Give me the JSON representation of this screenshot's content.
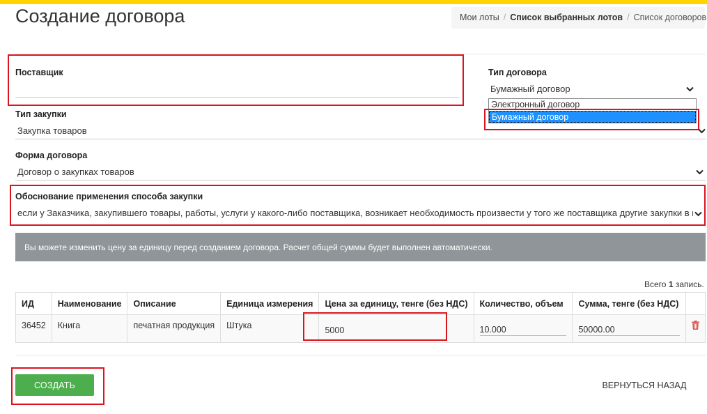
{
  "page": {
    "title": "Создание договора"
  },
  "breadcrumb": {
    "items": [
      "Мои лоты",
      "Список выбранных лотов",
      "Список договоров"
    ],
    "separator": "/"
  },
  "form": {
    "supplier": {
      "label": "Поставщик",
      "value": ""
    },
    "contract_type": {
      "label": "Тип договора",
      "value": "Бумажный договор",
      "options": [
        "Электронный договор",
        "Бумажный договор"
      ],
      "selected_index": 1,
      "dropdown_open": true
    },
    "purchase_type": {
      "label": "Тип закупки",
      "value": "Закупка товаров"
    },
    "contract_form": {
      "label": "Форма договора",
      "value": "Договор о закупках товаров"
    },
    "justification": {
      "label": "Обоснование применения способа закупки",
      "value": "если у Заказчика, закупившего товары, работы, услуги у какого-либо поставщика, возникает необходимость произвести у того же поставщика другие закупки в целях"
    }
  },
  "info_bar": {
    "text": "Вы можете изменить цену за единицу перед созданием договора. Расчет общей суммы будет выполнен автоматически."
  },
  "total": {
    "prefix": "Всего",
    "count": "1",
    "suffix": "запись."
  },
  "table": {
    "headers": [
      "ИД",
      "Наименование",
      "Описание",
      "Единица измерения",
      "Цена за единицу, тенге (без НДС)",
      "Количество, объем",
      "Сумма, тенге (без НДС)"
    ],
    "rows": [
      {
        "id": "36452",
        "name": "Книга",
        "description": "печатная продукция",
        "unit": "Штука",
        "price": "5000",
        "quantity": "10.000",
        "sum": "50000.00"
      }
    ]
  },
  "actions": {
    "create_label": "СОЗДАТЬ",
    "back_label": "ВЕРНУТЬСЯ НАЗАД"
  },
  "colors": {
    "accent_topbar": "#ffd400",
    "highlight_red": "#d9141e",
    "create_button": "#4cae4c",
    "info_bar": "#8f9598",
    "selected_option": "#1e90ff",
    "trash": "#d9534f"
  },
  "icons": {
    "dropdown": "chevron-down-icon",
    "delete": "trash-icon"
  }
}
